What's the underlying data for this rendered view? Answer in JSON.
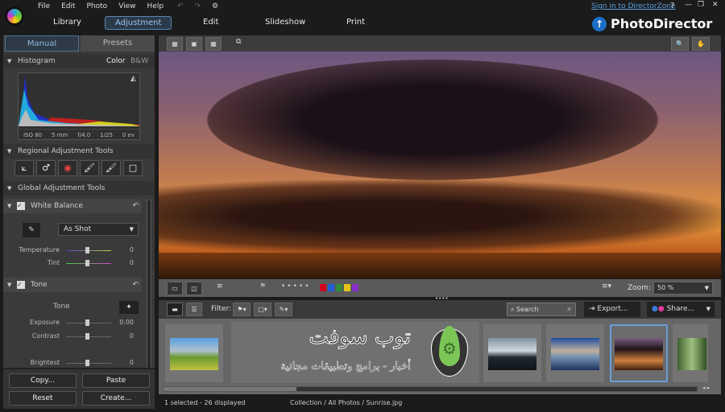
{
  "menu": [
    "File",
    "Edit",
    "Photo",
    "View",
    "Help"
  ],
  "nav": {
    "items": [
      "Library",
      "Adjustment",
      "Edit",
      "Slideshow",
      "Print"
    ],
    "selected": "Adjustment"
  },
  "header": {
    "sign_in": "Sign in to DirectorZone",
    "brand": "PhotoDirector",
    "help": "?"
  },
  "left": {
    "tabs": [
      "Manual",
      "Presets"
    ],
    "histogram": {
      "title": "Histogram",
      "modes": [
        "Color",
        "B&W"
      ],
      "info": [
        "ISO 80",
        "5 mm",
        "f/4.0",
        "1/25",
        "0 ev"
      ]
    },
    "regional_title": "Regional Adjustment Tools",
    "global_title": "Global Adjustment Tools",
    "white_balance": {
      "title": "White Balance",
      "preset": "As Shot",
      "sliders": [
        {
          "label": "Temperature",
          "value": "0"
        },
        {
          "label": "Tint",
          "value": "0"
        }
      ]
    },
    "tone": {
      "title": "Tone",
      "subtitle": "Tone",
      "sliders": [
        {
          "label": "Exposure",
          "value": "0.00"
        },
        {
          "label": "Contrast",
          "value": "0"
        },
        {
          "label": "Brightest",
          "value": "0"
        }
      ]
    },
    "buttons": {
      "copy": "Copy...",
      "paste": "Paste",
      "reset": "Reset",
      "create": "Create..."
    }
  },
  "viewer": {
    "zoom_label": "Zoom:",
    "zoom_value": "50 %",
    "color_labels": [
      "#d0021b",
      "#1f5fd6",
      "#2e8b3a",
      "#e8c21a",
      "#8b2fc9"
    ]
  },
  "filmstrip": {
    "filter_label": "Filter:",
    "search_placeholder": "Search",
    "export": "Export...",
    "share": "Share..."
  },
  "watermark": {
    "title": "توب سوفت",
    "subtitle": "أخبار - برامج وتطبيقات مجانية"
  },
  "status": {
    "selection": "1 selected - 26 displayed",
    "path": "Collection / All Photos / Sunrise.jpg"
  }
}
